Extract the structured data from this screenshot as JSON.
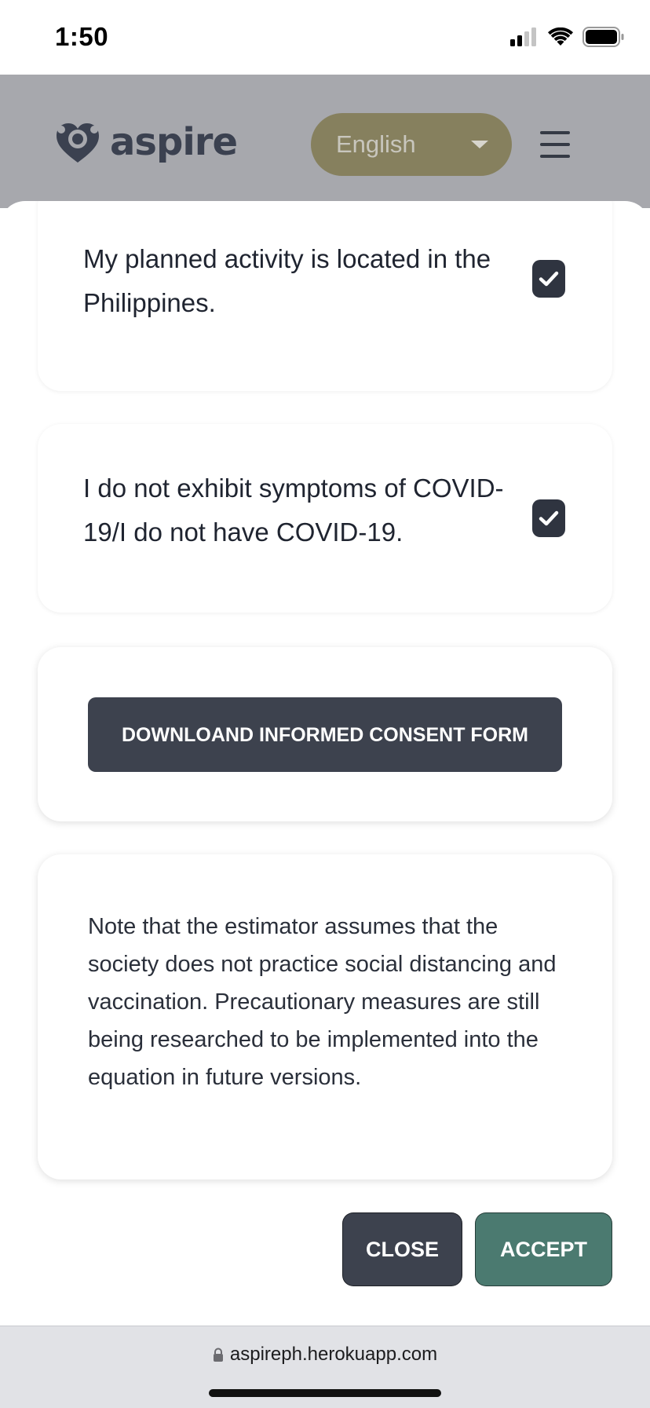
{
  "status_bar": {
    "time": "1:50"
  },
  "header": {
    "logo_text": "aspire",
    "language": "English"
  },
  "cards": [
    {
      "text": "My planned activity is located in the Philippines.",
      "checked": true
    },
    {
      "text": "I do not exhibit symptoms of COVID-19/I do not have COVID-19.",
      "checked": true
    }
  ],
  "consent": {
    "download_label": "DOWNLOAND INFORMED CONSENT FORM"
  },
  "note": {
    "text": "Note that the estimator assumes that the society does not practice social distancing and vaccination. Precautionary measures are still being researched to be implemented into the equation in future versions."
  },
  "actions": {
    "close_label": "CLOSE",
    "accept_label": "ACCEPT"
  },
  "browser": {
    "url": "aspireph.herokuapp.com"
  },
  "colors": {
    "header_bg": "#a7a8ad",
    "language_pill": "#86805e",
    "dark_button": "#3d424e",
    "accept_button": "#4b7a70"
  }
}
